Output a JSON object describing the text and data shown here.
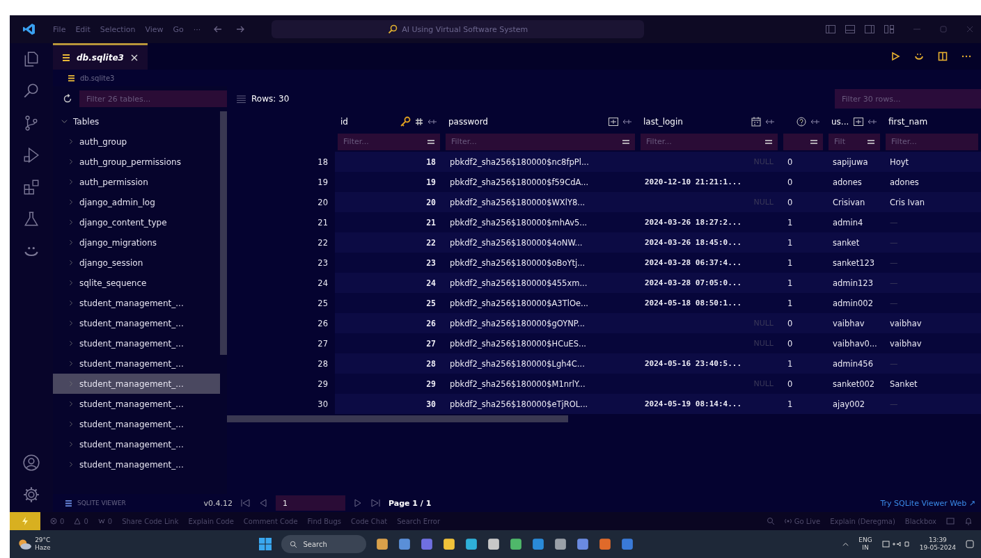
{
  "title_bar": {
    "menu": [
      "File",
      "Edit",
      "Selection",
      "View",
      "Go",
      "···"
    ],
    "command_center": "AI Using Virtual Software System"
  },
  "activity_bar": {
    "items": [
      {
        "kind": "explorer",
        "selected": false
      },
      {
        "kind": "search",
        "selected": false
      },
      {
        "kind": "source-control",
        "selected": false
      },
      {
        "kind": "run",
        "selected": false
      },
      {
        "kind": "extensions",
        "selected": false
      },
      {
        "kind": "testing",
        "selected": false
      },
      {
        "kind": "assistant",
        "selected": false
      }
    ],
    "bottom": [
      {
        "kind": "account"
      },
      {
        "kind": "settings"
      }
    ]
  },
  "tabs": [
    {
      "label": "db.sqlite3",
      "selected": true
    }
  ],
  "breadcrumb": "db.sqlite3",
  "sidebar": {
    "filter_placeholder": "Filter 26 tables...",
    "group": {
      "label": "Tables",
      "expanded": true,
      "children": [
        {
          "label": "auth_group",
          "selected": false
        },
        {
          "label": "auth_group_permissions",
          "selected": false
        },
        {
          "label": "auth_permission",
          "selected": false
        },
        {
          "label": "django_admin_log",
          "selected": false
        },
        {
          "label": "django_content_type",
          "selected": false
        },
        {
          "label": "django_migrations",
          "selected": false
        },
        {
          "label": "django_session",
          "selected": false
        },
        {
          "label": "sqlite_sequence",
          "selected": false
        },
        {
          "label": "student_management_...",
          "selected": false
        },
        {
          "label": "student_management_...",
          "selected": false
        },
        {
          "label": "student_management_...",
          "selected": false
        },
        {
          "label": "student_management_...",
          "selected": false
        },
        {
          "label": "student_management_...",
          "selected": true
        },
        {
          "label": "student_management_...",
          "selected": false
        },
        {
          "label": "student_management_...",
          "selected": false
        },
        {
          "label": "student_management_...",
          "selected": false
        },
        {
          "label": "student_management_...",
          "selected": false
        }
      ]
    },
    "footer": {
      "name": "SQLITE VIEWER",
      "version": "v0.4.12"
    }
  },
  "toolbar": {
    "rows": "Rows: 30",
    "filter_placeholder": "Filter 30 rows..."
  },
  "table": {
    "columns": [
      {
        "label": "id",
        "kind": "key",
        "filter_placeholder": "Filter..."
      },
      {
        "label": "password",
        "kind": "text",
        "filter_placeholder": "Filter..."
      },
      {
        "label": "last_login",
        "kind": "date",
        "filter_placeholder": "Filter..."
      },
      {
        "kind": "bool"
      },
      {
        "label": "us...",
        "kind": "text",
        "filter_placeholder": "Filt"
      },
      {
        "label": "first_nam",
        "kind": "plain",
        "filter_placeholder": "Filter..."
      }
    ],
    "rows": [
      {
        "row": "18",
        "id": "18",
        "password": "pbkdf2_sha256$180000$nc8fpPl...",
        "last_login": "NULL",
        "last_login_null": true,
        "is_superuser": "0",
        "username": "sapijuwa",
        "first_name": "Hoyt",
        "first_name_empty": false
      },
      {
        "row": "19",
        "id": "19",
        "password": "pbkdf2_sha256$180000$f59CdA...",
        "last_login": "2020-12-10 21:21:1...",
        "last_login_null": false,
        "is_superuser": "0",
        "username": "adones",
        "first_name": "adones",
        "first_name_empty": false
      },
      {
        "row": "20",
        "id": "20",
        "password": "pbkdf2_sha256$180000$WXlY8...",
        "last_login": "NULL",
        "last_login_null": true,
        "is_superuser": "0",
        "username": "Crisivan",
        "first_name": "Cris Ivan",
        "first_name_empty": false
      },
      {
        "row": "21",
        "id": "21",
        "password": "pbkdf2_sha256$180000$mhAv5...",
        "last_login": "2024-03-26 18:27:2...",
        "last_login_null": false,
        "is_superuser": "1",
        "username": "admin4",
        "first_name": "—",
        "first_name_empty": true
      },
      {
        "row": "22",
        "id": "22",
        "password": "pbkdf2_sha256$180000$4oNW...",
        "last_login": "2024-03-26 18:45:0...",
        "last_login_null": false,
        "is_superuser": "1",
        "username": "sanket",
        "first_name": "—",
        "first_name_empty": true
      },
      {
        "row": "23",
        "id": "23",
        "password": "pbkdf2_sha256$180000$oBoYtj...",
        "last_login": "2024-03-28 06:37:4...",
        "last_login_null": false,
        "is_superuser": "1",
        "username": "sanket123",
        "first_name": "—",
        "first_name_empty": true
      },
      {
        "row": "24",
        "id": "24",
        "password": "pbkdf2_sha256$180000$455xm...",
        "last_login": "2024-03-28 07:05:0...",
        "last_login_null": false,
        "is_superuser": "1",
        "username": "admin123",
        "first_name": "—",
        "first_name_empty": true
      },
      {
        "row": "25",
        "id": "25",
        "password": "pbkdf2_sha256$180000$A3TlOe...",
        "last_login": "2024-05-18 08:50:1...",
        "last_login_null": false,
        "is_superuser": "1",
        "username": "admin002",
        "first_name": "—",
        "first_name_empty": true
      },
      {
        "row": "26",
        "id": "26",
        "password": "pbkdf2_sha256$180000$gOYNP...",
        "last_login": "NULL",
        "last_login_null": true,
        "is_superuser": "0",
        "username": "vaibhav",
        "first_name": "vaibhav",
        "first_name_empty": false
      },
      {
        "row": "27",
        "id": "27",
        "password": "pbkdf2_sha256$180000$HCuES...",
        "last_login": "NULL",
        "last_login_null": true,
        "is_superuser": "0",
        "username": "vaibhav0...",
        "first_name": "vaibhav",
        "first_name_empty": false
      },
      {
        "row": "28",
        "id": "28",
        "password": "pbkdf2_sha256$180000$Lgh4C...",
        "last_login": "2024-05-16 23:40:5...",
        "last_login_null": false,
        "is_superuser": "1",
        "username": "admin456",
        "first_name": "—",
        "first_name_empty": true
      },
      {
        "row": "29",
        "id": "29",
        "password": "pbkdf2_sha256$180000$M1nrlY...",
        "last_login": "NULL",
        "last_login_null": true,
        "is_superuser": "0",
        "username": "sanket002",
        "first_name": "Sanket",
        "first_name_empty": false
      },
      {
        "row": "30",
        "id": "30",
        "password": "pbkdf2_sha256$180000$eTjROL...",
        "last_login": "2024-05-19 08:14:4...",
        "last_login_null": false,
        "is_superuser": "1",
        "username": "ajay002",
        "first_name": "—",
        "first_name_empty": true
      }
    ]
  },
  "pager": {
    "page_value": "1",
    "page_label": "Page 1 / 1",
    "link": "Try SQLite Viewer Web ↗"
  },
  "status_bar": {
    "left": [
      {
        "kind": "errors",
        "text": "0"
      },
      {
        "kind": "warnings",
        "text": "0"
      },
      {
        "kind": "ports",
        "text": "0"
      },
      {
        "kind": "plain",
        "text": "Share Code Link"
      },
      {
        "kind": "plain",
        "text": "Explain Code"
      },
      {
        "kind": "plain",
        "text": "Comment Code"
      },
      {
        "kind": "plain",
        "text": "Find Bugs"
      },
      {
        "kind": "plain",
        "text": "Code Chat"
      },
      {
        "kind": "plain",
        "text": "Search Error"
      }
    ],
    "right": [
      {
        "kind": "zoom"
      },
      {
        "kind": "live",
        "text": "Go Live"
      },
      {
        "kind": "plain",
        "text": "Explain (Deregma)"
      },
      {
        "kind": "plain",
        "text": "Blackbox"
      },
      {
        "kind": "layout"
      },
      {
        "kind": "bell"
      }
    ]
  },
  "taskbar": {
    "weather": {
      "temp": "29°C",
      "condition": "Haze"
    },
    "search": "Search",
    "lang": "ENG",
    "region": "IN",
    "time": "13:39",
    "date": "19-05-2024"
  }
}
